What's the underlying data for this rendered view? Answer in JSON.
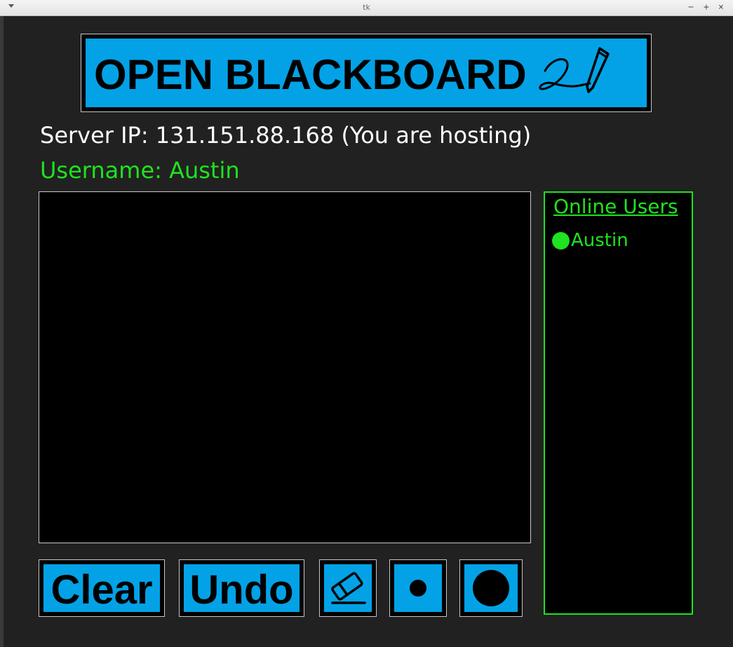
{
  "window": {
    "title": "tk",
    "controls": {
      "minimize": "−",
      "maximize": "+",
      "close": "×"
    }
  },
  "banner": {
    "title": "OPEN BLACKBOARD",
    "icon": "pen-signature-icon"
  },
  "status": {
    "server_ip": "Server IP: 131.151.88.168 (You are hosting)",
    "username": "Username: Austin"
  },
  "users_panel": {
    "title": "Online Users",
    "users": [
      {
        "name": "Austin",
        "status_color": "#1ee31e"
      }
    ]
  },
  "toolbar": {
    "clear_label": "Clear",
    "undo_label": "Undo",
    "eraser_icon": "eraser-icon",
    "small_brush_icon": "small-dot-icon",
    "large_brush_icon": "large-dot-icon"
  },
  "colors": {
    "accent": "#03a2e6",
    "background": "#212121",
    "online_green": "#1ee31e",
    "canvas": "#000000"
  }
}
